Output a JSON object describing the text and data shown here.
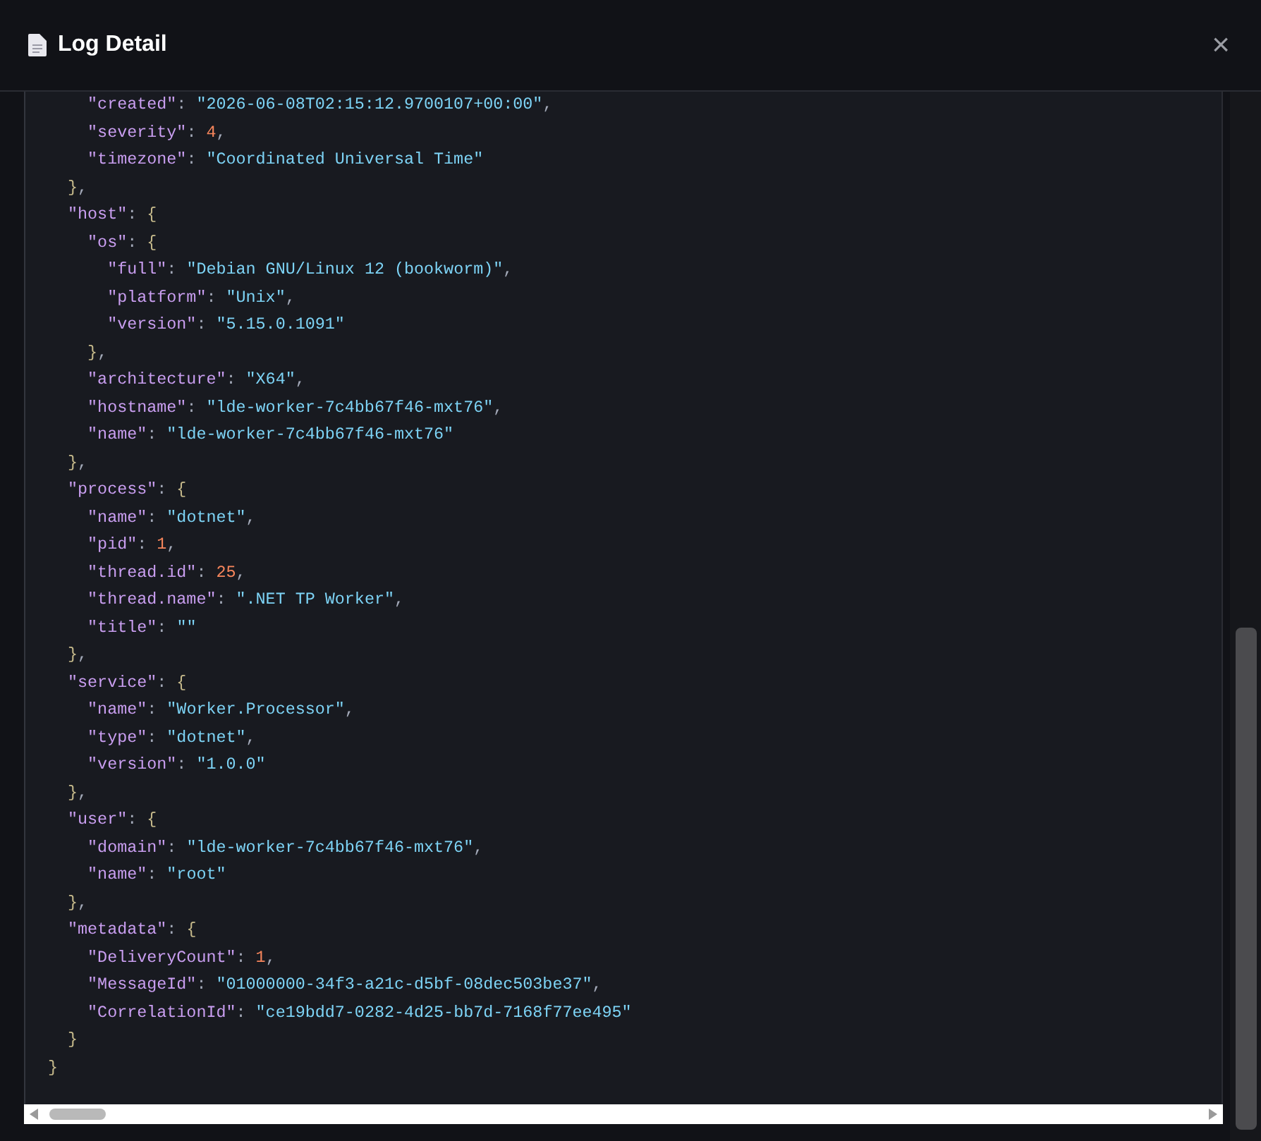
{
  "dialog": {
    "title": "Log Detail",
    "close_label": "×"
  },
  "json_view": {
    "close": "}",
    "children": [
      {
        "kind": "object",
        "close": "}",
        "comma": ",",
        "children": [
          {
            "kind": "string",
            "key": "\"created\"",
            "sep": ":",
            "value": "\"2026-06-08T02:15:12.9700107+00:00\"",
            "comma": ","
          },
          {
            "kind": "number",
            "key": "\"severity\"",
            "sep": ":",
            "value": "4",
            "comma": ","
          },
          {
            "kind": "string",
            "key": "\"timezone\"",
            "sep": ":",
            "value": "\"Coordinated Universal Time\""
          }
        ]
      },
      {
        "kind": "object",
        "key": "\"host\"",
        "sep": ":",
        "open": "{",
        "close": "}",
        "comma": ",",
        "children": [
          {
            "kind": "object",
            "key": "\"os\"",
            "sep": ":",
            "open": "{",
            "close": "}",
            "comma": ",",
            "children": [
              {
                "kind": "string",
                "key": "\"full\"",
                "sep": ":",
                "value": "\"Debian GNU/Linux 12 (bookworm)\"",
                "comma": ","
              },
              {
                "kind": "string",
                "key": "\"platform\"",
                "sep": ":",
                "value": "\"Unix\"",
                "comma": ","
              },
              {
                "kind": "string",
                "key": "\"version\"",
                "sep": ":",
                "value": "\"5.15.0.1091\""
              }
            ]
          },
          {
            "kind": "string",
            "key": "\"architecture\"",
            "sep": ":",
            "value": "\"X64\"",
            "comma": ","
          },
          {
            "kind": "string",
            "key": "\"hostname\"",
            "sep": ":",
            "value": "\"lde-worker-7c4bb67f46-mxt76\"",
            "comma": ","
          },
          {
            "kind": "string",
            "key": "\"name\"",
            "sep": ":",
            "value": "\"lde-worker-7c4bb67f46-mxt76\""
          }
        ]
      },
      {
        "kind": "object",
        "key": "\"process\"",
        "sep": ":",
        "open": "{",
        "close": "}",
        "comma": ",",
        "children": [
          {
            "kind": "string",
            "key": "\"name\"",
            "sep": ":",
            "value": "\"dotnet\"",
            "comma": ","
          },
          {
            "kind": "number",
            "key": "\"pid\"",
            "sep": ":",
            "value": "1",
            "comma": ","
          },
          {
            "kind": "number",
            "key": "\"thread.id\"",
            "sep": ":",
            "value": "25",
            "comma": ","
          },
          {
            "kind": "string",
            "key": "\"thread.name\"",
            "sep": ":",
            "value": "\".NET TP Worker\"",
            "comma": ","
          },
          {
            "kind": "string",
            "key": "\"title\"",
            "sep": ":",
            "value": "\"\""
          }
        ]
      },
      {
        "kind": "object",
        "key": "\"service\"",
        "sep": ":",
        "open": "{",
        "close": "}",
        "comma": ",",
        "children": [
          {
            "kind": "string",
            "key": "\"name\"",
            "sep": ":",
            "value": "\"Worker.Processor\"",
            "comma": ","
          },
          {
            "kind": "string",
            "key": "\"type\"",
            "sep": ":",
            "value": "\"dotnet\"",
            "comma": ","
          },
          {
            "kind": "string",
            "key": "\"version\"",
            "sep": ":",
            "value": "\"1.0.0\""
          }
        ]
      },
      {
        "kind": "object",
        "key": "\"user\"",
        "sep": ":",
        "open": "{",
        "close": "}",
        "comma": ",",
        "children": [
          {
            "kind": "string",
            "key": "\"domain\"",
            "sep": ":",
            "value": "\"lde-worker-7c4bb67f46-mxt76\"",
            "comma": ","
          },
          {
            "kind": "string",
            "key": "\"name\"",
            "sep": ":",
            "value": "\"root\""
          }
        ]
      },
      {
        "kind": "object",
        "key": "\"metadata\"",
        "sep": ":",
        "open": "{",
        "close": "}",
        "children": [
          {
            "kind": "number",
            "key": "\"DeliveryCount\"",
            "sep": ":",
            "value": "1",
            "comma": ","
          },
          {
            "kind": "string",
            "key": "\"MessageId\"",
            "sep": ":",
            "value": "\"01000000-34f3-a21c-d5bf-08dec503be37\"",
            "comma": ","
          },
          {
            "kind": "string",
            "key": "\"CorrelationId\"",
            "sep": ":",
            "value": "\"ce19bdd7-0282-4d25-bb7d-7168f77ee495\""
          }
        ]
      }
    ]
  }
}
